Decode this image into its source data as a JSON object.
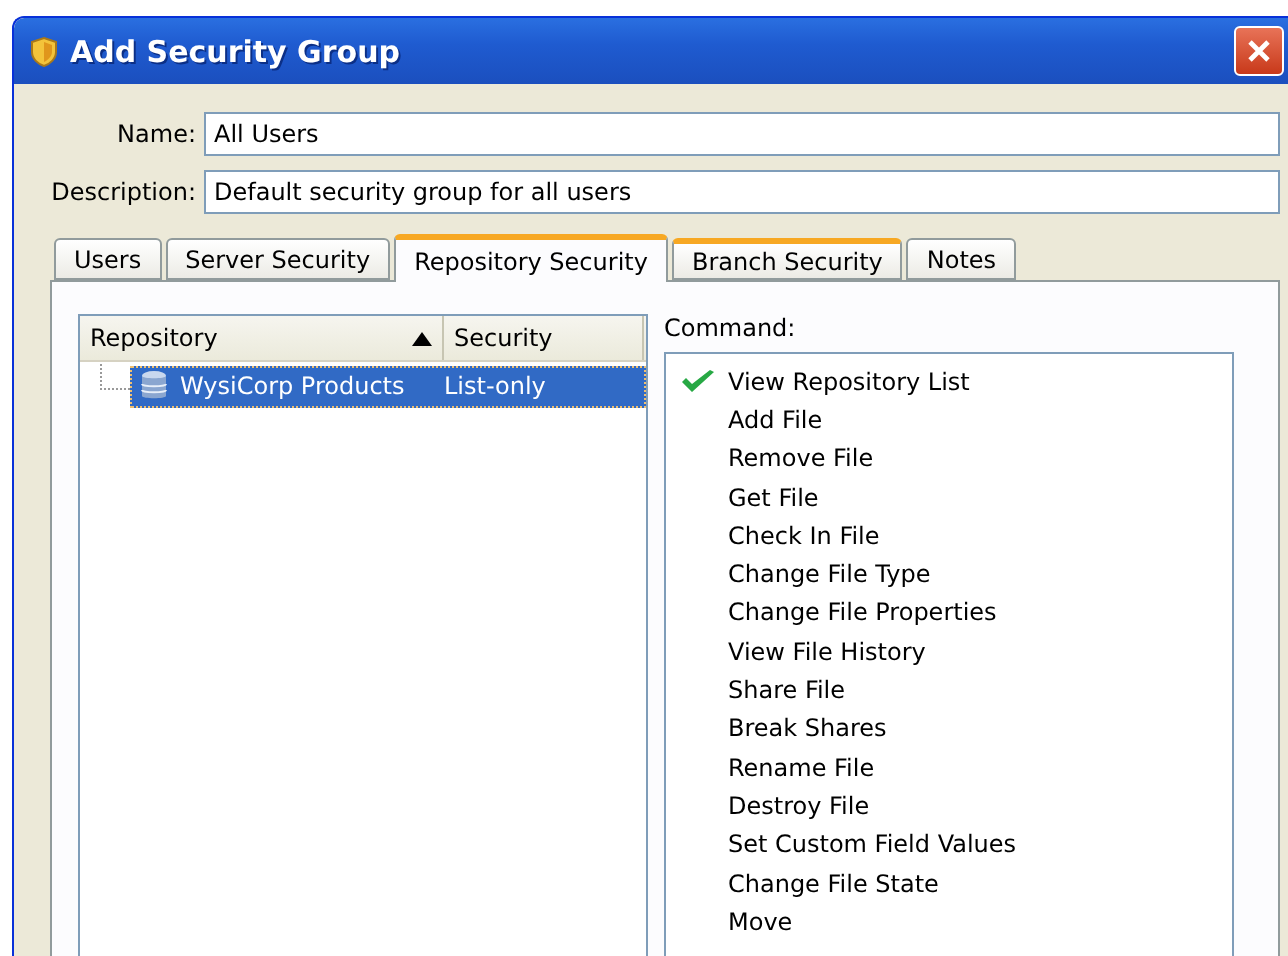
{
  "window": {
    "title": "Add Security Group"
  },
  "fields": [
    {
      "label": "Name:",
      "value": "All Users"
    },
    {
      "label": "Description:",
      "value": "Default security group for all users"
    }
  ],
  "tabs": [
    {
      "label": "Users",
      "selected": false,
      "hovered": false
    },
    {
      "label": "Server Security",
      "selected": false,
      "hovered": false
    },
    {
      "label": "Repository Security",
      "selected": true,
      "hovered": false
    },
    {
      "label": "Branch Security",
      "selected": false,
      "hovered": true
    },
    {
      "label": "Notes",
      "selected": false,
      "hovered": false
    }
  ],
  "tree": {
    "columns": [
      {
        "label": "Repository",
        "sorted": true
      },
      {
        "label": "Security",
        "sorted": false
      }
    ],
    "rows": [
      {
        "name": "WysiCorp Products",
        "security": "List-only",
        "selected": true
      }
    ]
  },
  "commands": {
    "label": "Command:",
    "items": [
      {
        "label": "View Repository List",
        "checked": true
      },
      {
        "label": "Add File",
        "checked": false
      },
      {
        "label": "Remove File",
        "checked": false
      },
      {
        "label": "Get File",
        "checked": false
      },
      {
        "label": "Check In File",
        "checked": false
      },
      {
        "label": "Change File Type",
        "checked": false
      },
      {
        "label": "Change File Properties",
        "checked": false
      },
      {
        "label": "View File History",
        "checked": false
      },
      {
        "label": "Share File",
        "checked": false
      },
      {
        "label": "Break Shares",
        "checked": false
      },
      {
        "label": "Rename File",
        "checked": false
      },
      {
        "label": "Destroy File",
        "checked": false
      },
      {
        "label": "Set Custom Field Values",
        "checked": false
      },
      {
        "label": "Change File State",
        "checked": false
      },
      {
        "label": "Move",
        "checked": false
      }
    ]
  }
}
